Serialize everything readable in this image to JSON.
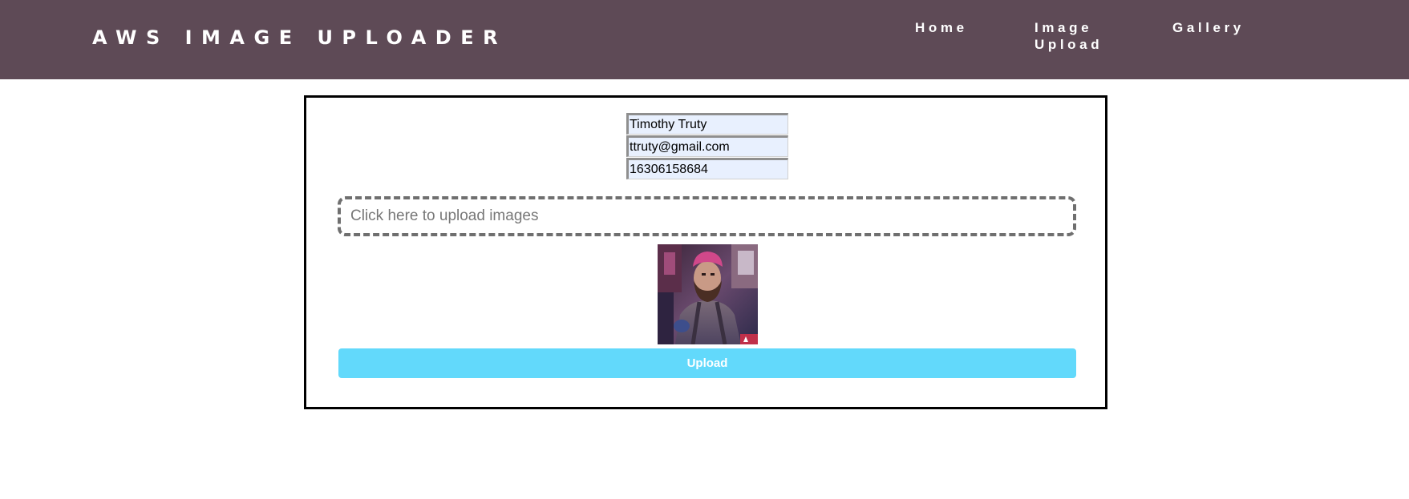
{
  "header": {
    "brand": "AWS IMAGE UPLOADER",
    "background_color": "#5e4a56",
    "nav": [
      {
        "label": "Home"
      },
      {
        "label": "Image\nUpload"
      },
      {
        "label": "Gallery"
      }
    ]
  },
  "form": {
    "name_value": "Timothy Truty",
    "email_value": "ttruty@gmail.com",
    "phone_value": "16306158684",
    "dropzone_label": "Click here to upload images",
    "preview_image": "image-thumbnail",
    "upload_label": "Upload",
    "upload_color": "#62d9fb"
  }
}
